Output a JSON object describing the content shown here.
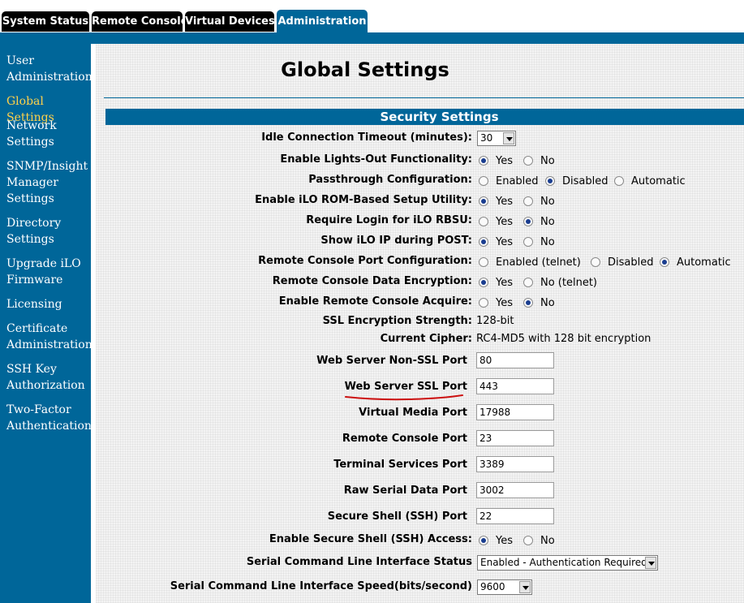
{
  "tabs": [
    {
      "label": "System Status"
    },
    {
      "label": "Remote Console"
    },
    {
      "label": "Virtual Devices"
    },
    {
      "label": "Administration"
    }
  ],
  "sidebar": [
    {
      "label": "User Administration",
      "lines": [
        "User",
        "Administration"
      ]
    },
    {
      "label": "Global Settings",
      "lines": [
        "Global Settings"
      ]
    },
    {
      "label": "Network Settings",
      "lines": [
        "Network",
        "Settings"
      ]
    },
    {
      "label": "SNMP/Insight Manager Settings",
      "lines": [
        "SNMP/Insight",
        "Manager",
        "Settings"
      ]
    },
    {
      "label": "Directory Settings",
      "lines": [
        "Directory",
        "Settings"
      ]
    },
    {
      "label": "Upgrade iLO Firmware",
      "lines": [
        "Upgrade iLO",
        "Firmware"
      ]
    },
    {
      "label": "Licensing",
      "lines": [
        "Licensing"
      ]
    },
    {
      "label": "Certificate Administration",
      "lines": [
        "Certificate",
        "Administration"
      ]
    },
    {
      "label": "SSH Key Authorization",
      "lines": [
        "SSH Key",
        "Authorization"
      ]
    },
    {
      "label": "Two-Factor Authentication",
      "lines": [
        "Two-Factor",
        "Authentication"
      ]
    }
  ],
  "page": {
    "title": "Global Settings",
    "section": "Security Settings"
  },
  "settings": {
    "idle_timeout": {
      "label": "Idle Connection Timeout (minutes):",
      "value": "30"
    },
    "lights_out": {
      "label": "Enable Lights-Out Functionality:",
      "options": [
        "Yes",
        "No"
      ],
      "selected": "Yes"
    },
    "passthrough": {
      "label": "Passthrough Configuration:",
      "options": [
        "Enabled",
        "Disabled",
        "Automatic"
      ],
      "selected": "Disabled"
    },
    "rbsu": {
      "label": "Enable iLO ROM-Based Setup Utility:",
      "options": [
        "Yes",
        "No"
      ],
      "selected": "Yes"
    },
    "require_login": {
      "label": "Require Login for iLO RBSU:",
      "options": [
        "Yes",
        "No"
      ],
      "selected": "No"
    },
    "show_ip": {
      "label": "Show iLO IP during POST:",
      "options": [
        "Yes",
        "No"
      ],
      "selected": "Yes"
    },
    "rc_port_config": {
      "label": "Remote Console Port Configuration:",
      "options": [
        "Enabled (telnet)",
        "Disabled",
        "Automatic"
      ],
      "selected": "Automatic"
    },
    "rc_encryption": {
      "label": "Remote Console Data Encryption:",
      "options": [
        "Yes",
        "No (telnet)"
      ],
      "selected": "Yes"
    },
    "rc_acquire": {
      "label": "Enable Remote Console Acquire:",
      "options": [
        "Yes",
        "No"
      ],
      "selected": "No"
    },
    "ssl_strength": {
      "label": "SSL Encryption Strength:",
      "value": "128-bit"
    },
    "cipher": {
      "label": "Current Cipher:",
      "value": "RC4-MD5 with 128 bit encryption"
    },
    "web_nonssl": {
      "label": "Web Server Non-SSL Port",
      "value": "80"
    },
    "web_ssl": {
      "label": "Web Server SSL Port",
      "value": "443"
    },
    "virtual_media": {
      "label": "Virtual Media Port",
      "value": "17988"
    },
    "rc_port": {
      "label": "Remote Console Port",
      "value": "23"
    },
    "ts_port": {
      "label": "Terminal Services Port",
      "value": "3389"
    },
    "raw_serial": {
      "label": "Raw Serial Data Port",
      "value": "3002"
    },
    "ssh_port": {
      "label": "Secure Shell (SSH) Port",
      "value": "22"
    },
    "ssh_access": {
      "label": "Enable Secure Shell (SSH) Access:",
      "options": [
        "Yes",
        "No"
      ],
      "selected": "Yes"
    },
    "cli_status": {
      "label": "Serial Command Line Interface Status",
      "value": "Enabled - Authentication Required"
    },
    "cli_speed": {
      "label": "Serial Command Line Interface Speed(bits/second)",
      "value": "9600"
    }
  },
  "colors": {
    "brand": "#006699",
    "active_nav": "#ffd24a",
    "annotation": "#cc1111"
  }
}
